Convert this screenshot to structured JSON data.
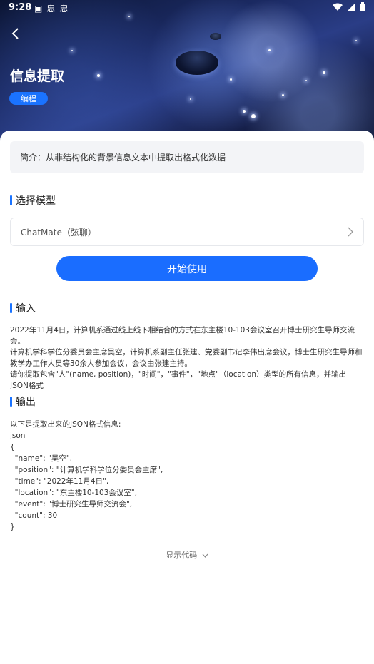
{
  "status_bar": {
    "time": "9:28",
    "left_icons": [
      "notification-a-icon",
      "bug-icon",
      "bug-icon"
    ],
    "right_icons": [
      "wifi-icon",
      "signal-icon",
      "battery-icon"
    ]
  },
  "header": {
    "title": "信息提取",
    "tag": "编程"
  },
  "intro": "简介：从非结构化的背景信息文本中提取出格式化数据",
  "model_section": {
    "title": "选择模型",
    "selected": "ChatMate（弦聊）"
  },
  "start_button": "开始使用",
  "input_section": {
    "title": "输入",
    "lines": [
      "2022年11月4日，计算机系通过线上线下相结合的方式在东主楼10-103会议室召开博士研究生导师交流会。",
      "计算机学科学位分委员会主席吴空，计算机系副主任张建、党委副书记李伟出席会议，博士生研究生导师和",
      "教学办工作人员等30余人参加会议，会议由张建主持。",
      "请你提取包含\"人\"(name, position)，\"时间\"，\"事件\"，\"地点\"（location）类型的所有信息，并输出JSON格式"
    ]
  },
  "output_section": {
    "title": "输出",
    "lines": [
      "以下是提取出来的JSON格式信息:",
      "json",
      "{",
      "  \"name\": \"吴空\",",
      "  \"position\": \"计算机学科学位分委员会主席\",",
      "  \"time\": \"2022年11月4日\",",
      "  \"location\": \"东主楼10-103会议室\",",
      "  \"event\": \"博士研究生导师交流会\",",
      "  \"count\": 30",
      "}"
    ]
  },
  "show_code": "显示代码"
}
